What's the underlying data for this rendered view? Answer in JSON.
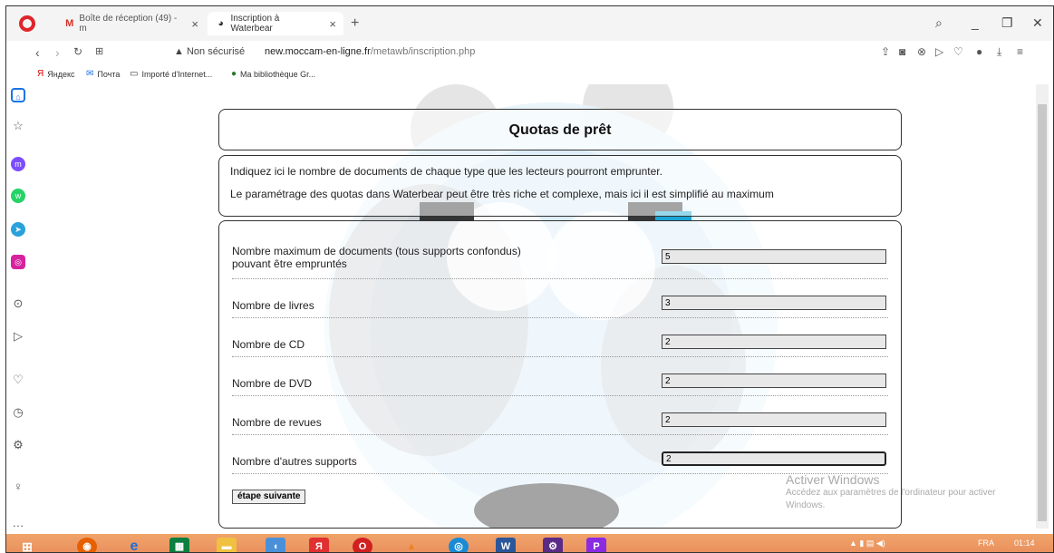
{
  "browser": {
    "tabs": [
      {
        "label": "Boîte de réception (49) - m"
      },
      {
        "label": "Inscription à Waterbear"
      }
    ],
    "security_label": "Non sécurisé",
    "url_domain": "new.moccam-en-ligne.fr",
    "url_path": "/metawb/inscription.php",
    "bookmarks": [
      {
        "label": "Яндекс"
      },
      {
        "label": "Почта"
      },
      {
        "label": "Importé d'Internet..."
      },
      {
        "label": "Ma bibliothèque Gr..."
      }
    ]
  },
  "page": {
    "title": "Quotas de prêt",
    "intro_1": "Indiquez ici le nombre de documents de chaque type que les lecteurs pourront emprunter.",
    "intro_2": "Le paramétrage des quotas dans Waterbear peut être très riche et complexe, mais ici il est simplifié au maximum",
    "fields": [
      {
        "label": "Nombre maximum de documents (tous supports confondus) pouvant être empruntés",
        "value": "5"
      },
      {
        "label": "Nombre de livres",
        "value": "3"
      },
      {
        "label": "Nombre de CD",
        "value": "2"
      },
      {
        "label": "Nombre de DVD",
        "value": "2"
      },
      {
        "label": "Nombre de revues",
        "value": "2"
      },
      {
        "label": "Nombre d'autres supports",
        "value": "2"
      }
    ],
    "next_button": "étape suivante"
  },
  "windows_notice": {
    "title": "Activer Windows",
    "body": "Accédez aux paramètres de l'ordinateur pour activer Windows."
  },
  "taskbar": {
    "lang": "FRA",
    "time": "01:14"
  },
  "colors": {
    "opera_red": "#e0242b",
    "taskbar": "#e8895a",
    "accent_blue": "#1a73e8"
  }
}
